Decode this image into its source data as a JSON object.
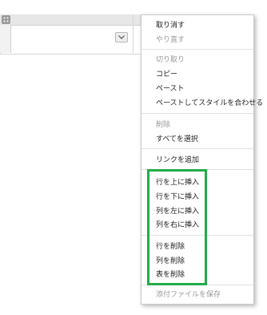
{
  "menu": {
    "group_edit": [
      {
        "label": "取り消す",
        "enabled": true
      },
      {
        "label": "やり直す",
        "enabled": false
      }
    ],
    "group_clipboard": [
      {
        "label": "切り取り",
        "enabled": false
      },
      {
        "label": "コピー",
        "enabled": true
      },
      {
        "label": "ペースト",
        "enabled": true
      },
      {
        "label": "ペーストしてスタイルを合わせる",
        "enabled": true
      }
    ],
    "group_select": [
      {
        "label": "削除",
        "enabled": false
      },
      {
        "label": "すべてを選択",
        "enabled": true
      }
    ],
    "group_link": [
      {
        "label": "リンクを追加",
        "enabled": true
      }
    ],
    "group_insert": [
      {
        "label": "行を上に挿入",
        "enabled": true
      },
      {
        "label": "行を下に挿入",
        "enabled": true
      },
      {
        "label": "列を左に挿入",
        "enabled": true
      },
      {
        "label": "列を右に挿入",
        "enabled": true
      }
    ],
    "group_delete": [
      {
        "label": "行を削除",
        "enabled": true
      },
      {
        "label": "列を削除",
        "enabled": true
      },
      {
        "label": "表を削除",
        "enabled": true
      }
    ],
    "group_attachment": [
      {
        "label": "添付ファイルを保存",
        "enabled": false
      }
    ]
  },
  "icons": {
    "table_handle": "grip-icon",
    "cell_dropdown": "chevron-down-icon"
  },
  "colors": {
    "highlight": "#22ab4b",
    "disabled_text": "#9a9a9a",
    "text": "#222222"
  }
}
